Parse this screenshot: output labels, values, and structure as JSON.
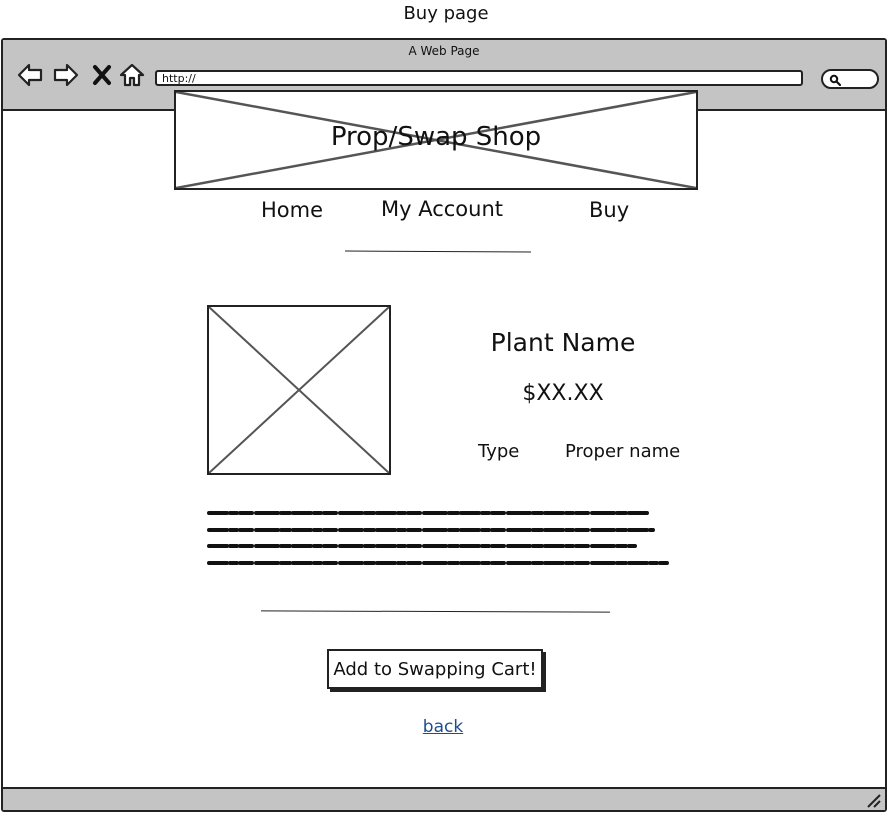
{
  "page_caption": "Buy page",
  "browser": {
    "window_title": "A Web Page",
    "url": "http://"
  },
  "banner": {
    "title": "Prop/Swap Shop"
  },
  "nav": {
    "items": [
      {
        "label": "Home"
      },
      {
        "label": "My Account"
      },
      {
        "label": "Buy"
      }
    ]
  },
  "product": {
    "name": "Plant Name",
    "price": "$XX.XX",
    "type_label": "Type",
    "proper_name_label": "Proper name"
  },
  "actions": {
    "add_to_cart_label": "Add to Swapping Cart!",
    "back_label": "back"
  },
  "icons": {
    "back": "arrow-left-icon",
    "forward": "arrow-right-icon",
    "stop": "close-icon",
    "home": "home-icon",
    "search": "search-icon",
    "resize": "resize-grip-icon"
  },
  "colors": {
    "chrome": "#c4c4c4",
    "link": "#1f4e8c",
    "ink": "#222222"
  }
}
